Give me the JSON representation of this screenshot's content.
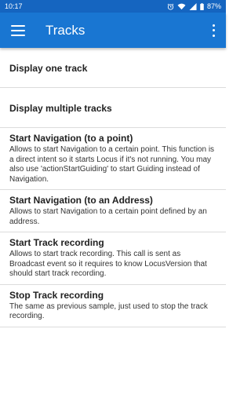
{
  "status_bar": {
    "time": "10:17",
    "battery": "87%",
    "icons": [
      "alarm-icon",
      "wifi-icon",
      "signal-icon",
      "battery-icon"
    ]
  },
  "app_bar": {
    "title": "Tracks",
    "menu_icon": "hamburger-menu-icon",
    "overflow_icon": "more-vertical-icon"
  },
  "colors": {
    "status_bar": "#1565c0",
    "app_bar": "#1976d2",
    "divider": "#dcdcdc"
  },
  "items": [
    {
      "title": "Display one track",
      "desc": ""
    },
    {
      "title": "Display multiple tracks",
      "desc": ""
    },
    {
      "title": "Start Navigation (to a point)",
      "desc": "Allows to start Navigation to a certain point. This function is a direct intent so it starts Locus if it's not running. You may also use 'actionStartGuiding' to start Guiding instead of Navigation."
    },
    {
      "title": "Start Navigation (to an Address)",
      "desc": "Allows to start Navigation to a certain point defined by an address."
    },
    {
      "title": "Start Track recording",
      "desc": "Allows to start track recording. This call is sent as Broadcast event so it requires to know LocusVersion that should start track recording."
    },
    {
      "title": "Stop Track recording",
      "desc": "The same as previous sample, just used to stop the track recording."
    }
  ]
}
